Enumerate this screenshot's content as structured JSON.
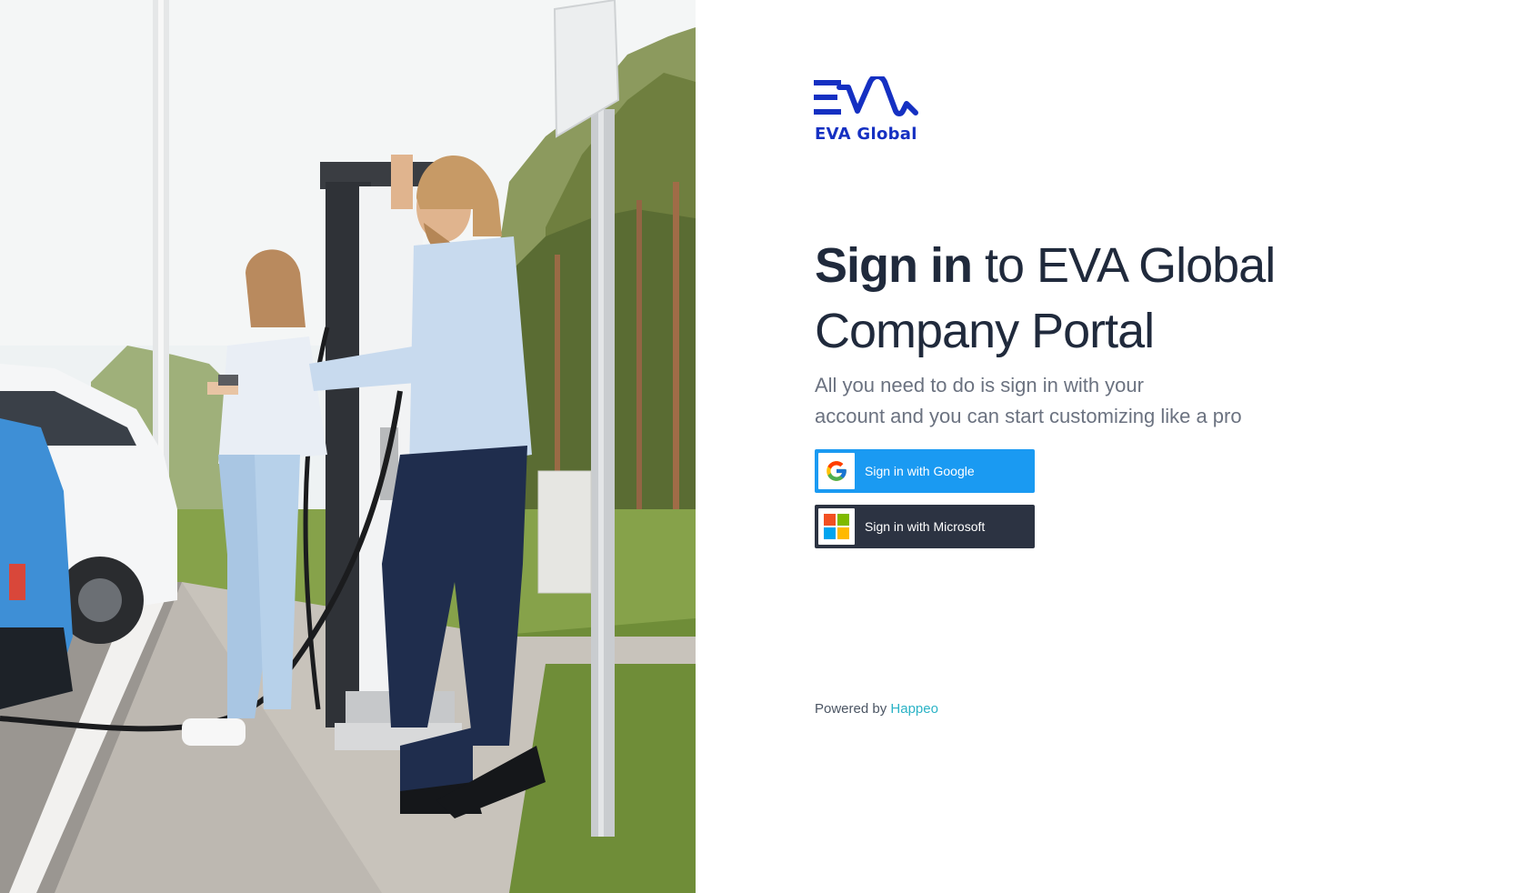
{
  "photo": {
    "description_icon": "ev-charging-photo"
  },
  "logo": {
    "mark_icon": "eva-wave-logo",
    "text": "EVA Global",
    "color": "#1530c2"
  },
  "headline": {
    "strong": "Sign in",
    "rest_line1": " to EVA Global",
    "line2": "Company Portal"
  },
  "subtitle": {
    "line1": "All you need to do is sign in with your",
    "line2": "account and you can start customizing like a pro"
  },
  "buttons": {
    "google": {
      "label": "Sign in with Google",
      "icon": "google-icon",
      "color": "#1a9af2"
    },
    "microsoft": {
      "label": "Sign in with Microsoft",
      "icon": "microsoft-icon",
      "color": "#2c3342"
    }
  },
  "footer": {
    "powered_prefix": "Powered by ",
    "brand": "Happeo",
    "brand_color": "#2bb3c6"
  }
}
